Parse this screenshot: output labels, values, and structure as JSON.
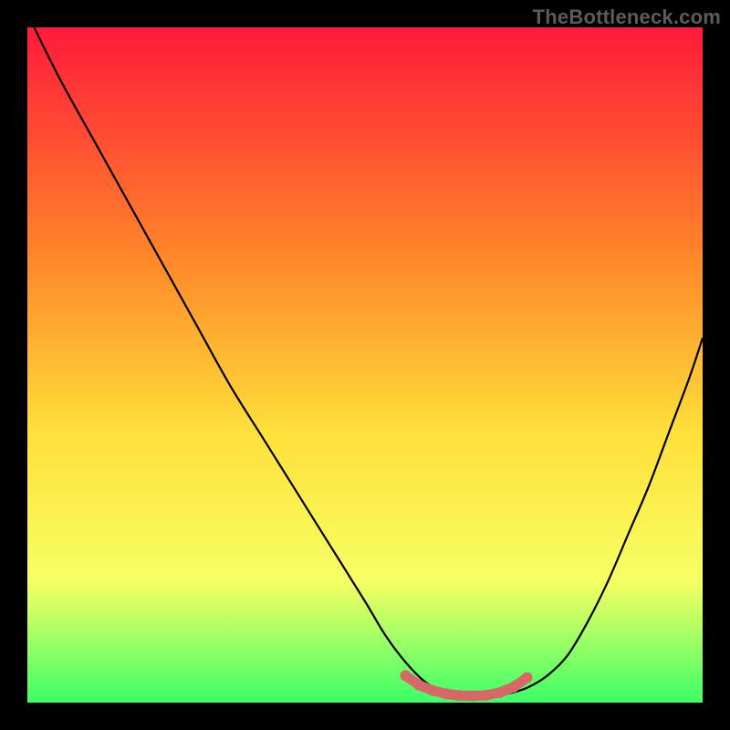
{
  "watermark": "TheBottleneck.com",
  "colors": {
    "frame": "#000000",
    "gradient_top": "#ff1a3a",
    "gradient_mid1": "#ff8a2a",
    "gradient_mid2": "#ffe03a",
    "gradient_mid3": "#f7ff64",
    "gradient_bottom": "#3cff66",
    "curve": "#000000",
    "marker": "#d86767"
  },
  "chart_data": {
    "type": "line",
    "title": "",
    "xlabel": "",
    "ylabel": "",
    "xlim": [
      0,
      100
    ],
    "ylim": [
      0,
      100
    ],
    "grid": false,
    "legend": false,
    "series": [
      {
        "name": "bottleneck-curve",
        "x": [
          1,
          5,
          10,
          15,
          20,
          25,
          30,
          35,
          40,
          45,
          50,
          53,
          56,
          59,
          62,
          65,
          68,
          71,
          74,
          77,
          80,
          83,
          86,
          89,
          92,
          95,
          98,
          100
        ],
        "y": [
          100,
          92,
          83,
          74,
          65,
          56,
          47,
          39,
          31,
          23,
          15,
          10,
          6,
          3,
          1.5,
          1,
          1,
          1.3,
          2.2,
          4,
          7,
          12,
          18,
          25,
          32,
          40,
          48,
          54
        ]
      }
    ],
    "markers": {
      "name": "optimal-range",
      "x": [
        56,
        58,
        60,
        62,
        64,
        66,
        68,
        70,
        72,
        74
      ],
      "y": [
        4.0,
        2.6,
        1.8,
        1.3,
        1.05,
        1.0,
        1.1,
        1.5,
        2.3,
        3.7
      ]
    }
  }
}
